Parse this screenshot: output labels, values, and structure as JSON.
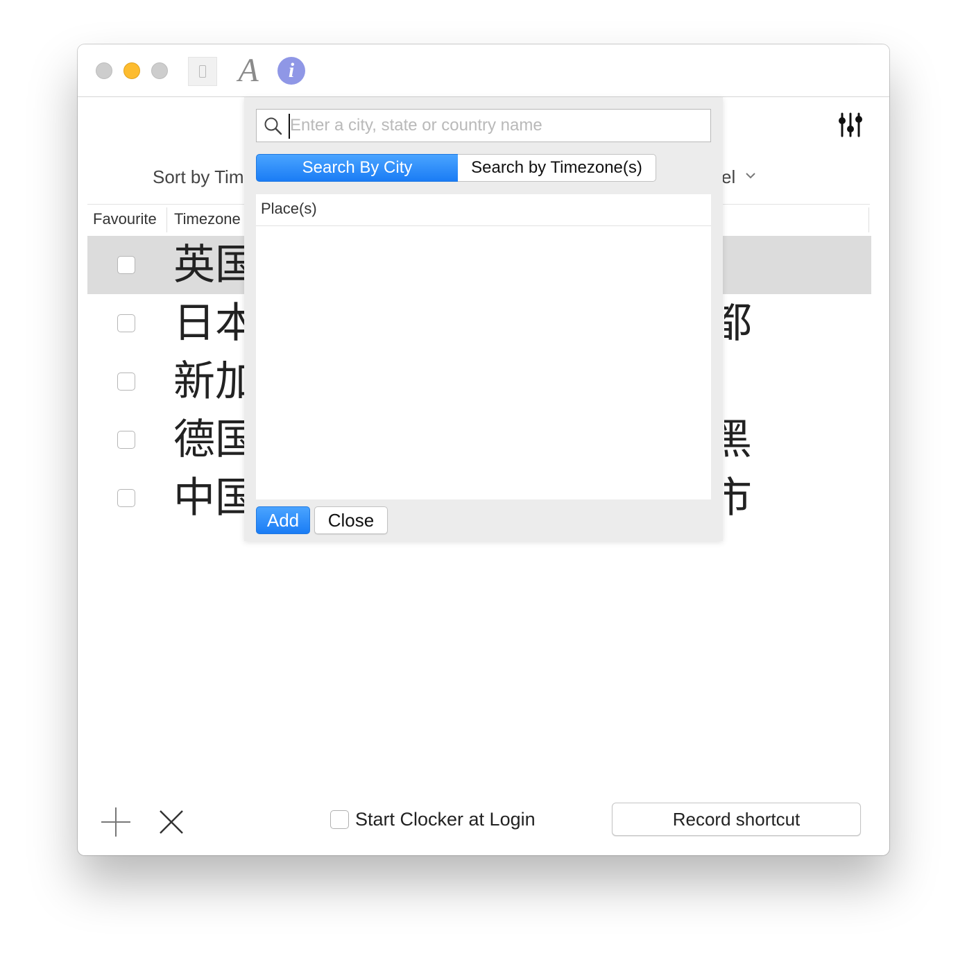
{
  "toolbar": {
    "font_glyph": "A",
    "info_glyph": "i"
  },
  "main": {
    "sort_label": "Sort by Time",
    "right_label_fragment": "el",
    "columns": {
      "favourite": "Favourite",
      "timezone": "Timezone"
    },
    "rows": [
      {
        "name": "英国",
        "tail": "",
        "selected": true
      },
      {
        "name": "日本",
        "tail": "都",
        "selected": false
      },
      {
        "name": "新加",
        "tail": "",
        "selected": false
      },
      {
        "name": "德国",
        "tail": "黑",
        "selected": false
      },
      {
        "name": "中国",
        "tail": "市",
        "selected": false
      }
    ]
  },
  "footer": {
    "start_login_label": "Start Clocker at Login",
    "record_shortcut_label": "Record shortcut"
  },
  "popover": {
    "search_placeholder": "Enter a city, state or country name",
    "search_value": "",
    "segments": {
      "city": "Search By City",
      "timezone": "Search by Timezone(s)"
    },
    "selected_segment": "city",
    "list_header": "Place(s)",
    "add_label": "Add",
    "close_label": "Close"
  },
  "colors": {
    "accent": "#1a7cf5",
    "minimize": "#fdbc2f",
    "info": "#8f97e6",
    "selected_row": "#dcdcdc"
  }
}
